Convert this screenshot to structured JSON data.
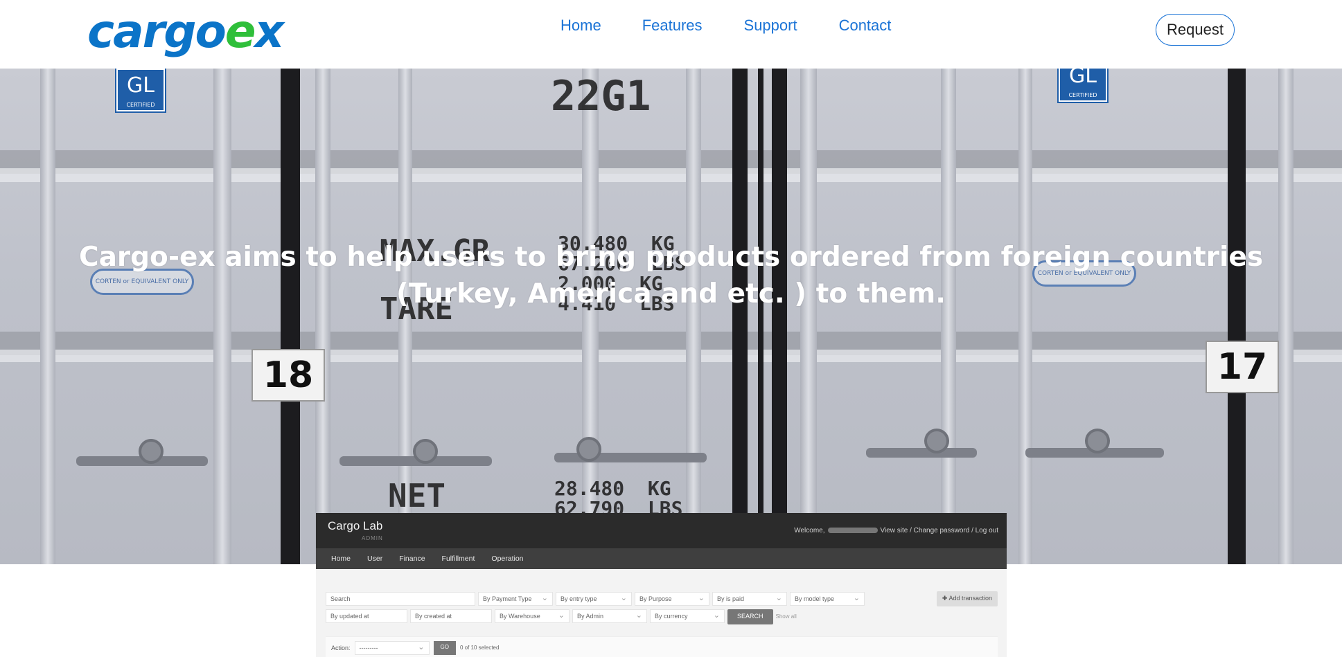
{
  "header": {
    "logo_main": "cargo",
    "logo_accent_letter": "e",
    "logo_tail": "x",
    "nav": [
      "Home",
      "Features",
      "Support",
      "Contact"
    ],
    "request_label": "Request"
  },
  "hero": {
    "line1": "Cargo-ex aims to help users to bring products ordered from foreign countries",
    "line2": "(Turkey, America and etc. ) to them.",
    "background": {
      "container_code": "22G1",
      "gl_text": "GL",
      "gl_sub": "CERTIFIED",
      "oval_text": "CORTEN or EQUIVALENT ONLY",
      "plate_left": "18",
      "plate_right": "17",
      "maxgr": "MAX.GR",
      "tare": "TARE",
      "net": "NET",
      "weights_top": "30.480  KG\n67.200  LBS\n2.000  KG\n4.410  LBS",
      "weights_bottom": "28.480  KG\n62.790  LBS"
    }
  },
  "preview": {
    "brand": "Cargo Lab",
    "brand_sub": "ADMIN",
    "welcome": "Welcome,",
    "user_links": "View site / Change password / Log out",
    "nav": [
      "Home",
      "User",
      "Finance",
      "Fulfillment",
      "Operation"
    ],
    "filters_row1": [
      "Search",
      "By Payment Type",
      "By entry type",
      "By Purpose",
      "By is paid",
      "By model type"
    ],
    "filters_row2": [
      "By updated at",
      "By created at",
      "By Warehouse",
      "By Admin",
      "By currency"
    ],
    "search_label": "SEARCH",
    "show_all": "Show all",
    "add_label": "✚ Add transaction",
    "action_label": "Action:",
    "action_value": "---------",
    "go_label": "GO",
    "selected_count": "0 of 10 selected"
  },
  "colors": {
    "logo_blue": "#0b74c8",
    "logo_green": "#2fbf3a",
    "nav_link": "#1a73d6",
    "admin_dark": "#2b2b2b"
  }
}
